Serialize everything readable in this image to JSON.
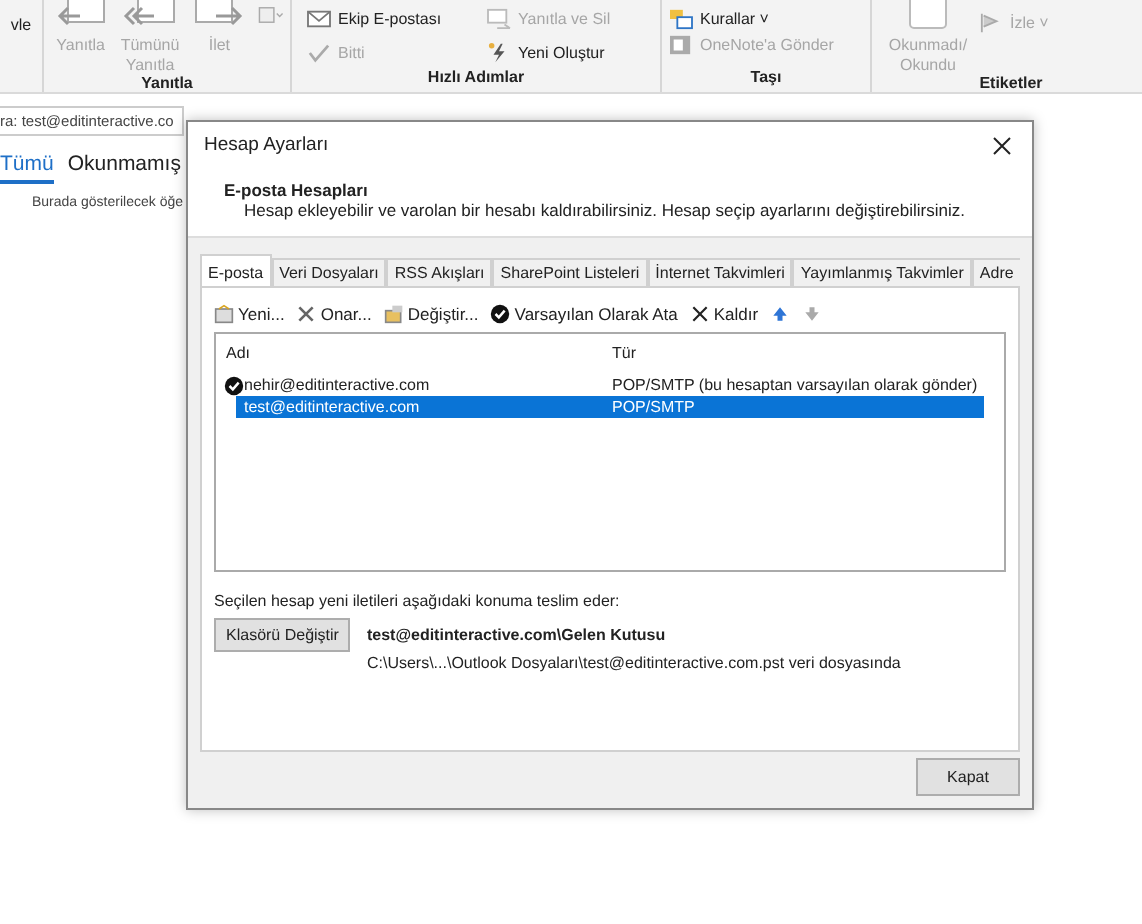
{
  "ribbon": {
    "groups": [
      {
        "items": [
          {
            "label": "vle",
            "kind": "large",
            "disabled": false
          }
        ]
      },
      {
        "label": "Yanıtla",
        "items": [
          {
            "label": "Yanıtla",
            "kind": "large",
            "disabled": true
          },
          {
            "label": "Tümünü Yanıtla",
            "kind": "large",
            "disabled": true
          },
          {
            "label": "İlet",
            "kind": "large",
            "disabled": true
          },
          {
            "kind": "small-icon",
            "disabled": true
          }
        ]
      },
      {
        "label": "Hızlı Adımlar",
        "items": [
          {
            "label": "Ekip E-postası",
            "kind": "small",
            "disabled": false
          },
          {
            "label": "Yanıtla ve Sil",
            "kind": "small",
            "disabled": true
          },
          {
            "label": "Bitti",
            "kind": "small",
            "disabled": true
          },
          {
            "label": "Yeni Oluştur",
            "kind": "small",
            "disabled": false
          }
        ]
      },
      {
        "label": "Taşı",
        "items": [
          {
            "label": "Kurallar ˅",
            "kind": "small",
            "disabled": false
          },
          {
            "label": "OneNote'a Gönder",
            "kind": "small",
            "disabled": true
          }
        ]
      },
      {
        "label": "Etiketler",
        "items": [
          {
            "label": "Okunmadı/ Okundu",
            "kind": "large",
            "disabled": true
          },
          {
            "label": "İzle ˅",
            "kind": "small",
            "disabled": true
          }
        ]
      }
    ]
  },
  "search": {
    "value": "ra: test@editinteractive.co"
  },
  "view_tabs": [
    {
      "label": "Tümü",
      "selected": true
    },
    {
      "label": "Okunmamış",
      "selected": false
    }
  ],
  "empty_message": "Burada gösterilecek öğe",
  "dialog": {
    "title": "Hesap Ayarları",
    "heading": "E-posta Hesapları",
    "description": "Hesap ekleyebilir ve varolan bir hesabı kaldırabilirsiniz. Hesap seçip ayarlarını değiştirebilirsiniz.",
    "tabs": [
      {
        "label": "E-posta",
        "selected": true
      },
      {
        "label": "Veri Dosyaları",
        "selected": false
      },
      {
        "label": "RSS Akışları",
        "selected": false
      },
      {
        "label": "SharePoint Listeleri",
        "selected": false
      },
      {
        "label": "İnternet Takvimleri",
        "selected": false
      },
      {
        "label": "Yayımlanmış Takvimler",
        "selected": false
      },
      {
        "label": "Adre",
        "selected": false
      }
    ],
    "toolbar": [
      {
        "label": "Yeni...",
        "kind": "new",
        "disabled": false
      },
      {
        "label": "Onar...",
        "kind": "repair",
        "disabled": false
      },
      {
        "label": "Değiştir...",
        "kind": "change",
        "disabled": false
      },
      {
        "label": "Varsayılan Olarak Ata",
        "kind": "default",
        "disabled": false
      },
      {
        "label": "Kaldır",
        "kind": "remove",
        "disabled": false
      },
      {
        "kind": "up",
        "disabled": false
      },
      {
        "kind": "down",
        "disabled": true
      }
    ],
    "columns": [
      "Adı",
      "Tür"
    ],
    "accounts": [
      {
        "name": "nehir@editinteractive.com",
        "type": "POP/SMTP (bu hesaptan varsayılan olarak gönder)",
        "default": true,
        "selected": false
      },
      {
        "name": "test@editinteractive.com",
        "type": "POP/SMTP",
        "default": false,
        "selected": true
      }
    ],
    "delivery_note": "Seçilen hesap yeni iletileri aşağıdaki konuma teslim eder:",
    "change_folder_button": "Klasörü Değiştir",
    "folder": "test@editinteractive.com\\Gelen Kutusu",
    "data_file": "C:\\Users\\...\\Outlook Dosyaları\\test@editinteractive.com.pst veri dosyasında",
    "close_button": "Kapat"
  }
}
